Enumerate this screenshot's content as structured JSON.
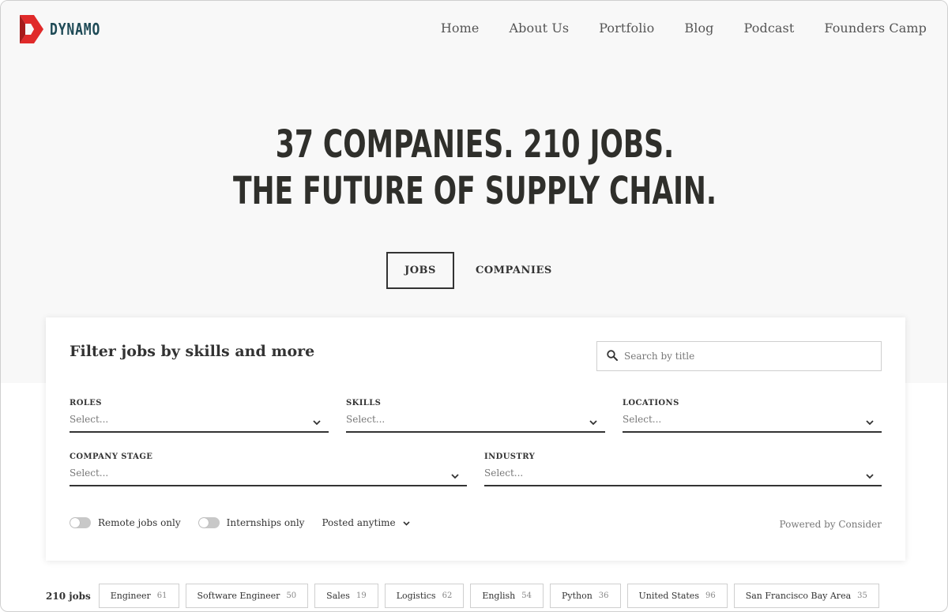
{
  "brand": {
    "name": "DYNAMO",
    "logo_colors": [
      "#e02a2a",
      "#a61b1b"
    ],
    "text_color": "#1e4a56"
  },
  "nav": [
    {
      "label": "Home"
    },
    {
      "label": "About Us"
    },
    {
      "label": "Portfolio"
    },
    {
      "label": "Blog"
    },
    {
      "label": "Podcast"
    },
    {
      "label": "Founders Camp"
    }
  ],
  "hero": {
    "line1": "37 COMPANIES. 210 JOBS.",
    "line2": "THE FUTURE OF SUPPLY CHAIN."
  },
  "tabs": {
    "jobs": "JOBS",
    "companies": "COMPANIES",
    "active": "jobs"
  },
  "filter": {
    "title": "Filter jobs by skills and more",
    "search_placeholder": "Search by title",
    "fields": {
      "roles": {
        "label": "ROLES",
        "value": "Select..."
      },
      "skills": {
        "label": "SKILLS",
        "value": "Select..."
      },
      "locations": {
        "label": "LOCATIONS",
        "value": "Select..."
      },
      "company_stage": {
        "label": "COMPANY STAGE",
        "value": "Select..."
      },
      "industry": {
        "label": "INDUSTRY",
        "value": "Select..."
      }
    },
    "remote_label": "Remote jobs only",
    "internships_label": "Internships only",
    "posted_label": "Posted anytime",
    "powered_by": "Powered by Consider"
  },
  "results": {
    "count_label": "210 jobs",
    "chips": [
      {
        "label": "Engineer",
        "count": "61"
      },
      {
        "label": "Software Engineer",
        "count": "50"
      },
      {
        "label": "Sales",
        "count": "19"
      },
      {
        "label": "Logistics",
        "count": "62"
      },
      {
        "label": "English",
        "count": "54"
      },
      {
        "label": "Python",
        "count": "36"
      },
      {
        "label": "United States",
        "count": "96"
      },
      {
        "label": "San Francisco Bay Area",
        "count": "35"
      }
    ]
  }
}
